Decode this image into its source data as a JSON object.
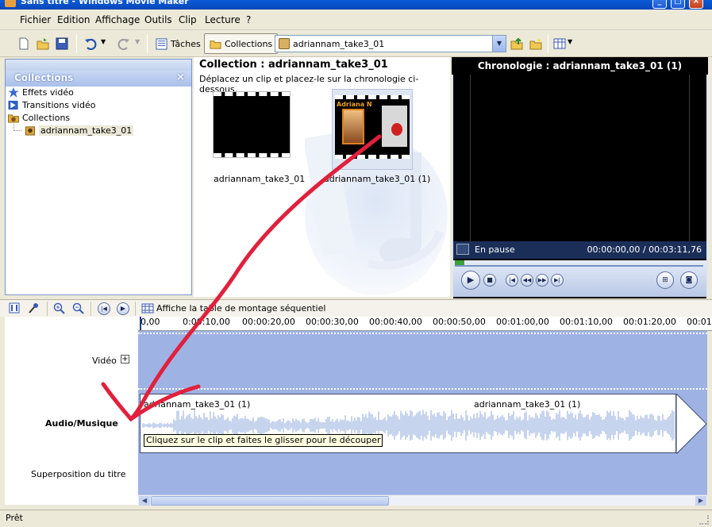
{
  "window": {
    "title": "Sans titre - Windows Movie Maker"
  },
  "menu": [
    "Fichier",
    "Edition",
    "Affichage",
    "Outils",
    "Clip",
    "Lecture",
    "?"
  ],
  "toolbar": {
    "tasks_label": "Tâches",
    "collections_label": "Collections",
    "combo_value": "adriannam_take3_01"
  },
  "left_pane": {
    "title": "Collections",
    "items": [
      "Effets vidéo",
      "Transitions vidéo",
      "Collections",
      "adriannam_take3_01"
    ]
  },
  "collection": {
    "title": "Collection : adriannam_take3_01",
    "subtitle": "Déplacez un clip et placez-le sur la chronologie ci-dessous.",
    "clips": [
      {
        "name": "adriannam_take3_01",
        "thumb_text": ""
      },
      {
        "name": "adriannam_take3_01 (1)",
        "thumb_text": "Adriana N"
      }
    ]
  },
  "preview": {
    "title": "Chronologie : adriannam_take3_01 (1)",
    "status": "En pause",
    "time": "00:00:00,00 / 00:03:11,76"
  },
  "timeline": {
    "toolbar_label": "Affiche la table de montage séquentiel",
    "ruler": [
      "0,00",
      "0:00:10,00",
      "00:00:20,00",
      "00:00:30,00",
      "00:00:40,00",
      "00:00:50,00",
      "00:01:00,00",
      "00:01:10,00",
      "00:01:20,00",
      "00:01"
    ],
    "tracks": {
      "video": "Vidéo",
      "audio": "Audio/Musique",
      "title": "Superposition du titre"
    },
    "audio_clip_label_1": "adriannam_take3_01 (1)",
    "audio_clip_label_2": "adriannam_take3_01 (1)",
    "tooltip": "Cliquez sur le clip et faites le glisser pour le découper"
  },
  "status": {
    "text": "Prêt"
  },
  "colors": {
    "track": "#9fb2e4",
    "annotation_arrow": "#e0203c",
    "titlebar": "#0a5bd8"
  }
}
